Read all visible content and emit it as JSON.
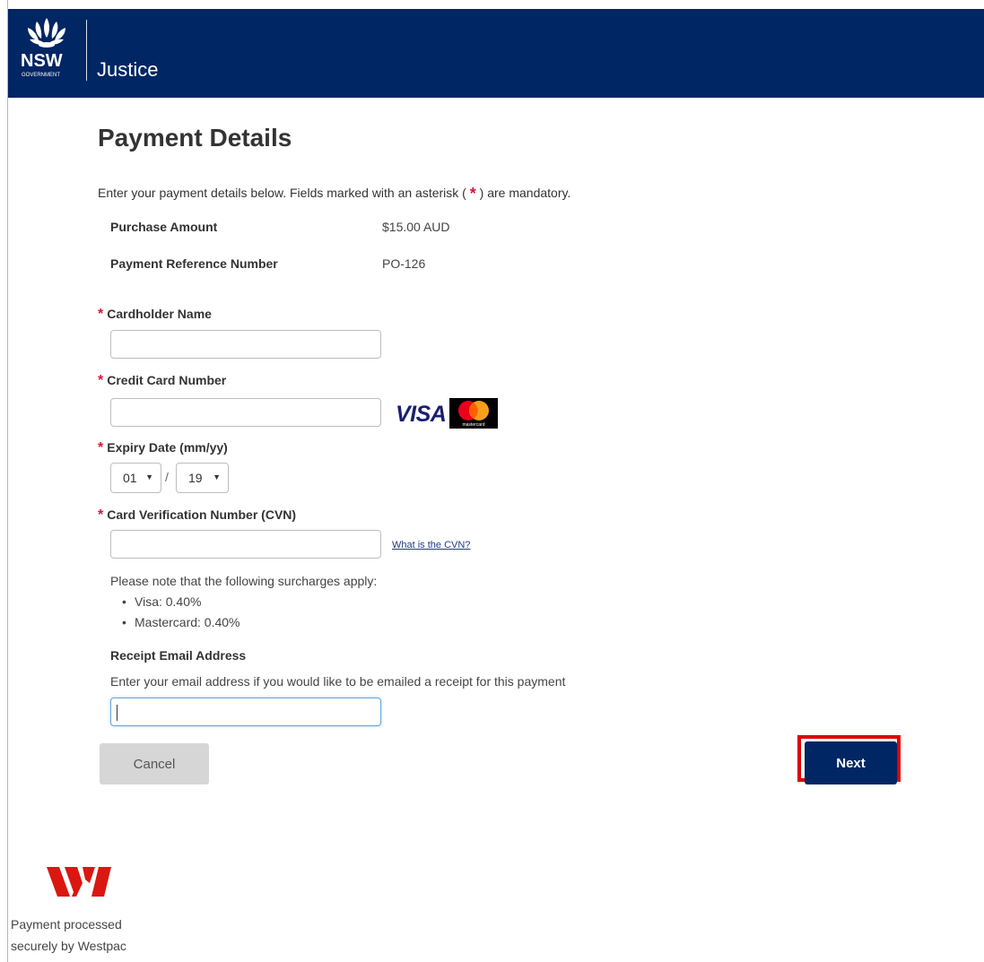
{
  "header": {
    "logo_text": "NSW",
    "logo_subtext": "GOVERNMENT",
    "title": "Justice"
  },
  "page": {
    "title": "Payment Details",
    "intro_before": "Enter your payment details below. Fields marked with an asterisk ( ",
    "intro_asterisk": "*",
    "intro_after": " ) are mandatory."
  },
  "summary": [
    {
      "label": "Purchase Amount",
      "value": "$15.00 AUD"
    },
    {
      "label": "Payment Reference Number",
      "value": "PO-126"
    }
  ],
  "form": {
    "required_mark": "*",
    "cardholder_name": {
      "label": "Cardholder Name",
      "value": ""
    },
    "card_number": {
      "label": "Credit Card Number",
      "value": ""
    },
    "expiry": {
      "label": "Expiry Date (mm/yy)",
      "month": "01",
      "separator": "/",
      "year": "19"
    },
    "cvn": {
      "label": "Card Verification Number (CVN)",
      "value": "",
      "help_link": "What is the CVN?"
    },
    "surcharge_note": "Please note that the following surcharges apply:",
    "surcharges": [
      "Visa: 0.40%",
      "Mastercard: 0.40%"
    ],
    "email": {
      "label": "Receipt Email Address",
      "help": "Enter your email address if you would like to be emailed a receipt for this payment",
      "value": ""
    }
  },
  "card_logos": {
    "visa": "VISA",
    "mastercard": "mastercard"
  },
  "buttons": {
    "cancel": "Cancel",
    "next": "Next"
  },
  "footer": {
    "line1": "Payment processed",
    "line2": "securely by Westpac"
  },
  "colors": {
    "header_bg": "#002664",
    "required_red": "#d7153a",
    "highlight_red": "#e00000",
    "westpac_red": "#da1710"
  },
  "icons": [
    "nsw-waratah-icon",
    "visa-logo",
    "mastercard-logo",
    "westpac-logo",
    "chevron-down-icon"
  ]
}
